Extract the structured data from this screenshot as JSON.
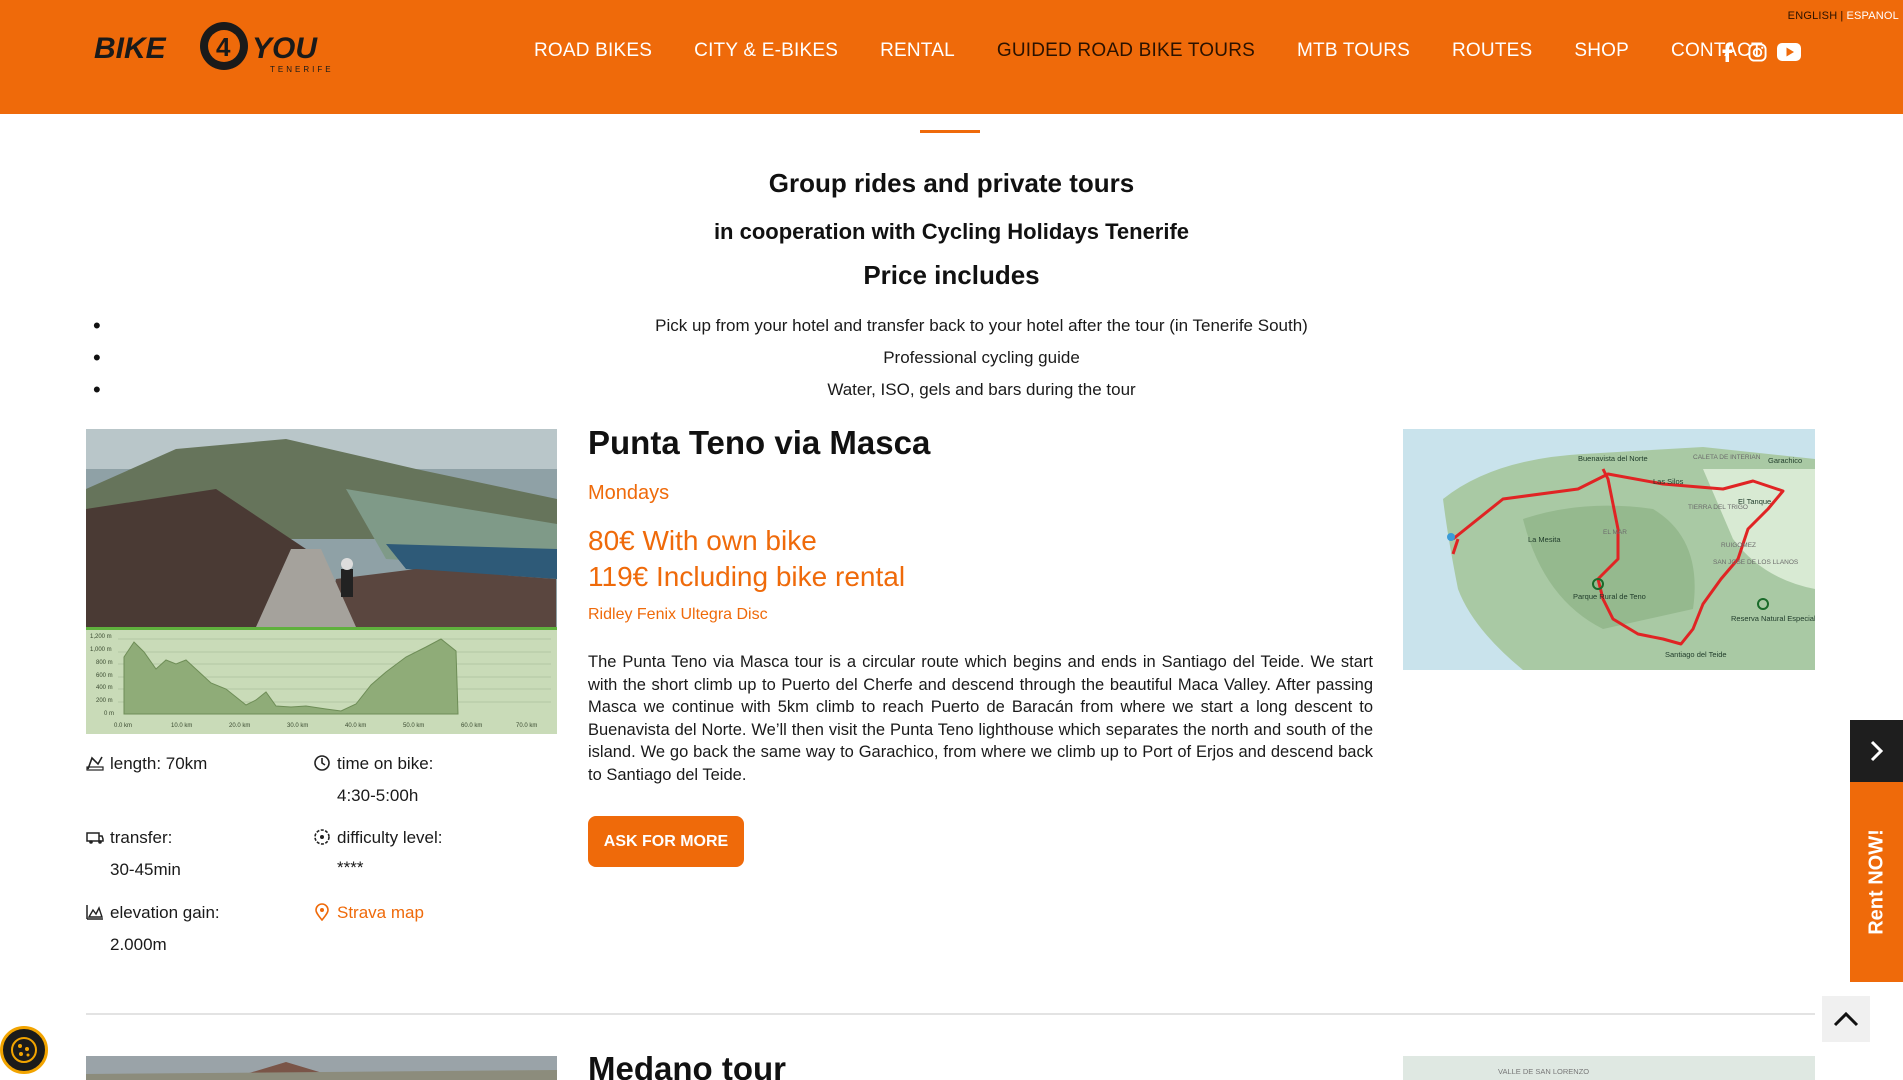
{
  "header": {
    "logo_text": "BIKE 4 YOU",
    "logo_subtext": "TENERIFE",
    "languages": [
      "ENGLISH",
      "ESPANOL"
    ],
    "language_separator": "|",
    "nav": [
      {
        "label": "ROAD BIKES",
        "active": false
      },
      {
        "label": "CITY & E-BIKES",
        "active": false
      },
      {
        "label": "RENTAL",
        "active": false
      },
      {
        "label": "GUIDED ROAD BIKE TOURS",
        "active": true
      },
      {
        "label": "MTB TOURS",
        "active": false
      },
      {
        "label": "ROUTES",
        "active": false
      },
      {
        "label": "SHOP",
        "active": false
      },
      {
        "label": "CONTACT",
        "active": false
      }
    ],
    "socials": [
      "facebook-icon",
      "instagram-icon",
      "youtube-icon"
    ]
  },
  "intro": {
    "title": "Group rides and private tours",
    "subtitle": "in cooperation with Cycling Holidays Tenerife",
    "includes_title": "Price includes",
    "includes": [
      "Pick up from your hotel and transfer back to your hotel after the tour (in Tenerife South)",
      "Professional cycling guide",
      "Water, ISO, gels and bars during the tour"
    ]
  },
  "tour": {
    "title": "Punta Teno via Masca",
    "day": "Mondays",
    "price_own_bike": "80€ With own bike",
    "price_rental": "119€ Including bike rental",
    "bike_model": "Ridley Fenix Ultegra Disc",
    "description": "The Punta Teno via Masca tour is a circular route which begins and ends in Santiago del Teide. We start with the short climb up to Puerto del Cherfe and descend through the beautiful Maca Valley. After passing Masca we continue with 5km climb to reach Puerto de Baracán from where we start a long descent to Buenavista del Norte. We’ll then visit the Punta Teno lighthouse which separates the north and south of the island. We go back the same way to Garachico, from where we climb up to Port of Erjos and descend back to Santiago del Teide.",
    "ask_button": "ASK FOR MORE",
    "specs": {
      "length_label": "length: 70km",
      "time_label": "time on bike:",
      "time_value": "4:30-5:00h",
      "transfer_label": "transfer:",
      "transfer_value": "30-45min",
      "difficulty_label": "difficulty level:",
      "difficulty_value": "****",
      "elevation_label": "elevation gain:",
      "elevation_value": "2.000m",
      "strava_label": "Strava map"
    },
    "profile_y_labels": [
      "1,200 m",
      "1,000 m",
      "800 m",
      "600 m",
      "400 m",
      "200 m",
      "0 m"
    ],
    "profile_x_labels": [
      "0.0 km",
      "10.0 km",
      "20.0 km",
      "30.0 km",
      "40.0 km",
      "50.0 km",
      "60.0 km",
      "70.0 km"
    ],
    "map_labels": [
      "Buenavista del Norte",
      "CALETA DE INTERIAN",
      "Garachico",
      "Las Silos",
      "El Tanque",
      "TIERRA DEL TRIGO",
      "La Mesita",
      "EL MAR",
      "RUIGOMEZ",
      "SAN JOSE DE LOS LLANOS",
      "Parque Rural de Teno",
      "Reserva Natural Especial del Chinyero",
      "Santiago del Teide"
    ]
  },
  "tour2": {
    "title": "Medano tour",
    "map_label": "VALLE DE SAN LORENZO"
  },
  "widgets": {
    "rent_now": "Rent NOW!"
  },
  "colors": {
    "brand_orange": "#ef6a0a",
    "dark": "#1e1e1e"
  }
}
